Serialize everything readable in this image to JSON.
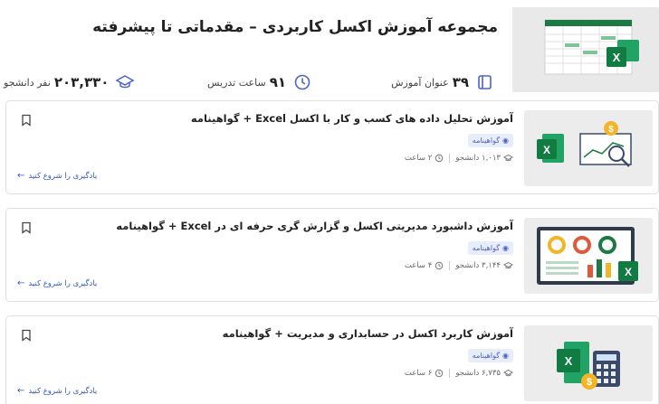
{
  "header": {
    "title": "مجموعه آموزش اکسل کاربردی – مقدماتی تا پیشرفته",
    "stats": {
      "lessons_value": "۳۹",
      "lessons_label": "عنوان آموزش",
      "hours_value": "۹۱",
      "hours_label": "ساعت تدریس",
      "students_value": "۲۰۳,۳۳۰",
      "students_label": "نفر دانشجو"
    }
  },
  "courses": [
    {
      "title": "آموزش تحلیل داده های کسب و کار با اکسل Excel + گواهینامه",
      "badge": "گواهینامه",
      "students": "۱,۰۱۳ دانشجو",
      "hours": "۲ ساعت",
      "cta": "یادگیری را شروع کنید"
    },
    {
      "title": "آموزش داشبورد مدیریتی اکسل و گزارش گری حرفه ای در Excel + گواهینامه",
      "badge": "گواهینامه",
      "students": "۳,۱۴۴ دانشجو",
      "hours": "۴ ساعت",
      "cta": "یادگیری را شروع کنید"
    },
    {
      "title": "آموزش کاربرد اکسل در حسابداری و مدیریت + گواهینامه",
      "badge": "گواهینامه",
      "students": "۶,۷۳۵ دانشجو",
      "hours": "۶ ساعت",
      "cta": "یادگیری را شروع کنید"
    }
  ],
  "colors": {
    "excel_green": "#1d7a44",
    "accent_blue": "#3558c8",
    "badge_bg": "#e8edfb",
    "coin_yellow": "#f3b526"
  }
}
